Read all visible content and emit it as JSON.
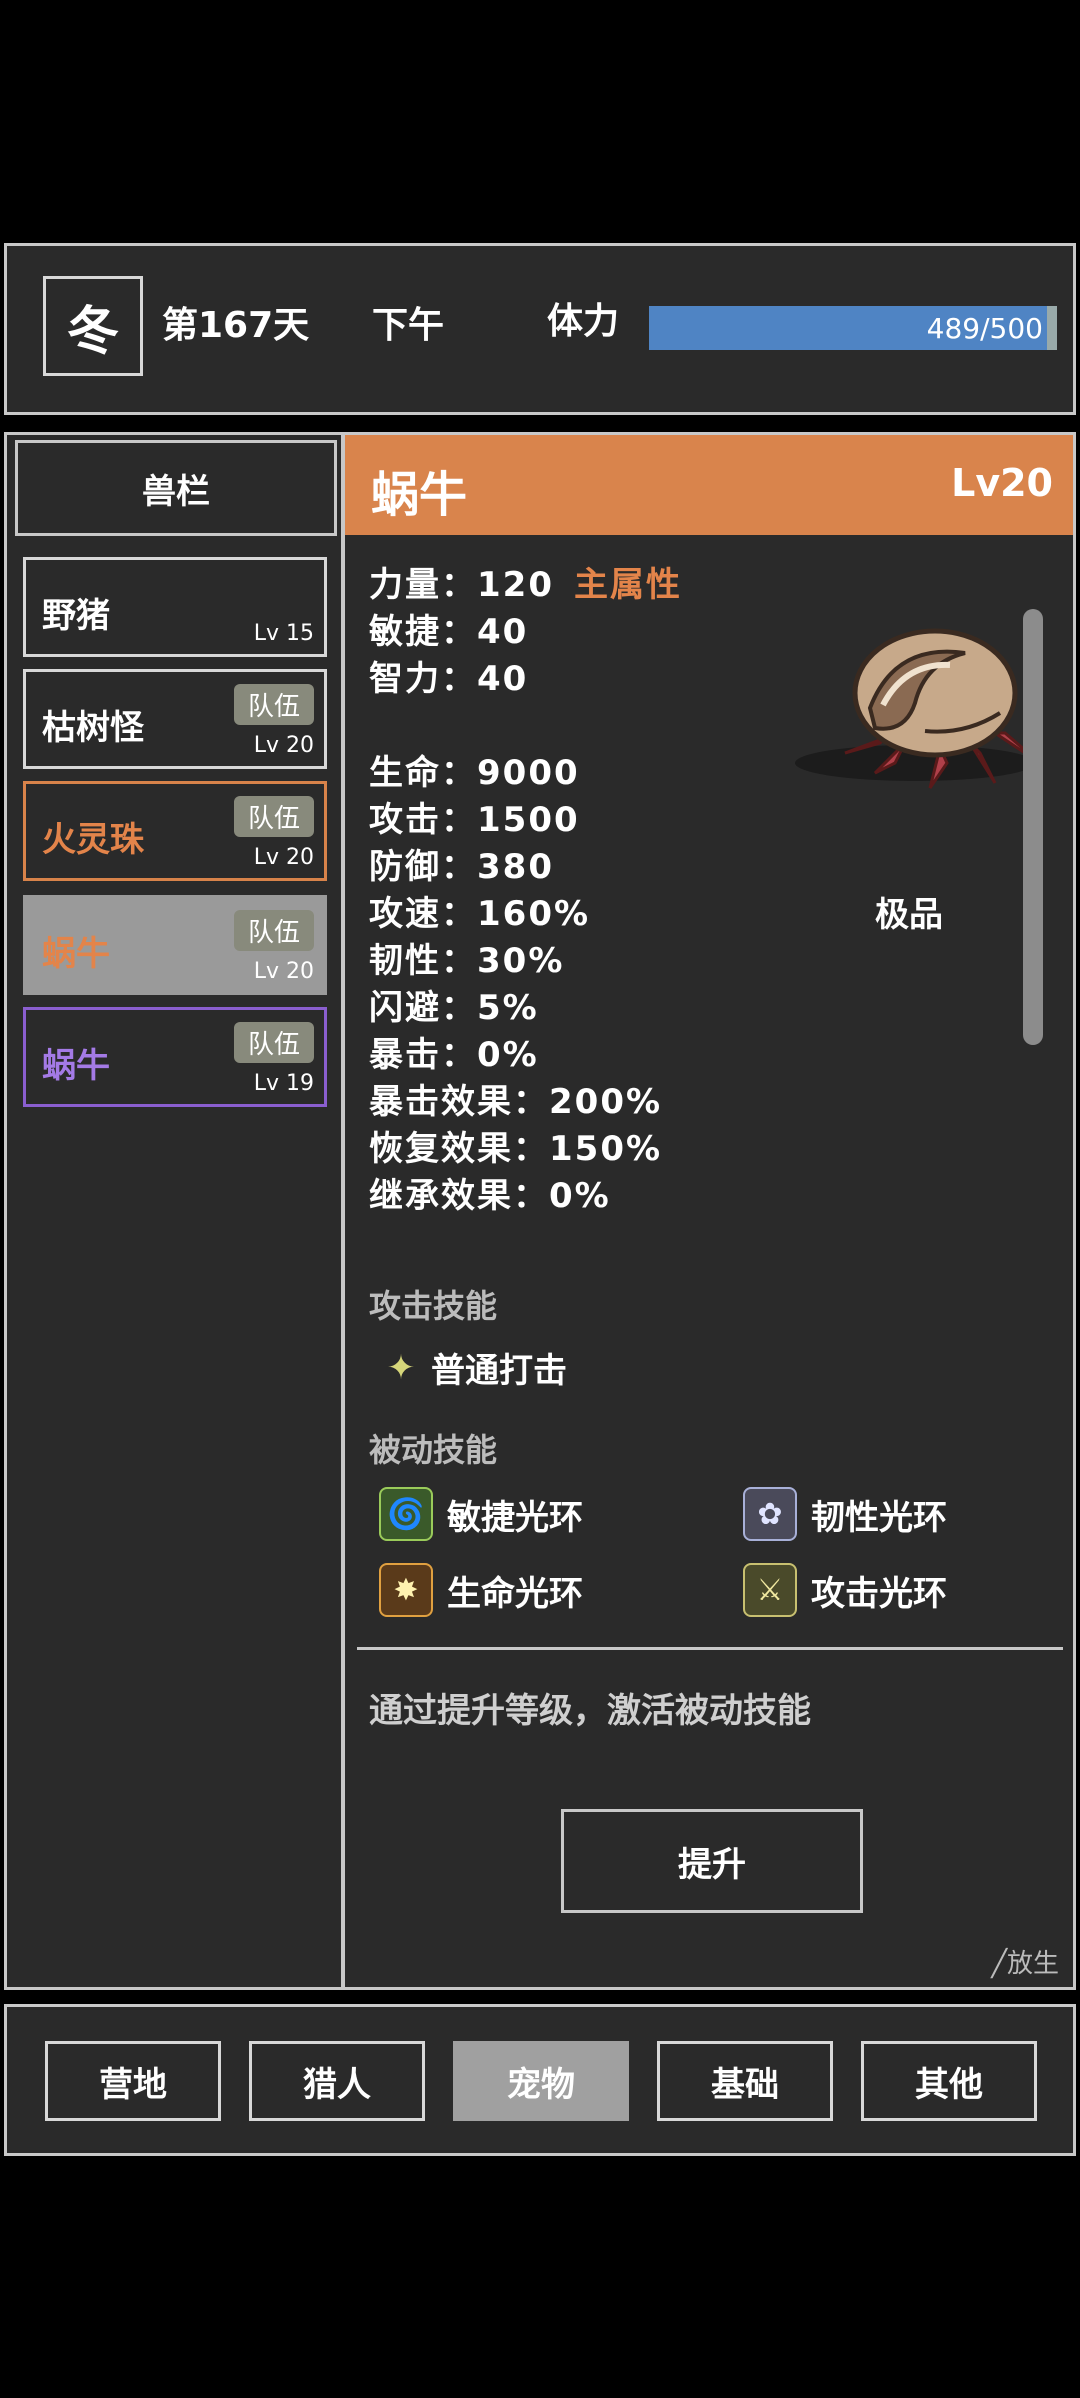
{
  "status": {
    "season": "冬",
    "day": "第167天",
    "time": "下午",
    "stamina_label": "体力",
    "stamina_text": "489/500",
    "stamina_fraction": 0.978
  },
  "pet_list": {
    "title": "兽栏",
    "items": [
      {
        "name": "野猪",
        "level": "Lv 15",
        "tag": ""
      },
      {
        "name": "枯树怪",
        "level": "Lv 20",
        "tag": "队伍"
      },
      {
        "name": "火灵珠",
        "level": "Lv 20",
        "tag": "队伍"
      },
      {
        "name": "蜗牛",
        "level": "Lv 20",
        "tag": "队伍"
      },
      {
        "name": "蜗牛",
        "level": "Lv 19",
        "tag": "队伍"
      }
    ]
  },
  "detail": {
    "name": "蜗牛",
    "level": "Lv20",
    "quality": "极品",
    "main_attr_label": "主属性",
    "stats": [
      "力量：120",
      "敏捷：40",
      "智力：40",
      "生命：9000",
      "攻击：1500",
      "防御：380",
      "攻速：160%",
      "韧性：30%",
      "闪避：5%",
      "暴击：0%",
      "暴击效果：200%",
      "恢复效果：150%",
      "继承效果：0%"
    ],
    "attack_skills_title": "攻击技能",
    "attack_skills": [
      "普通打击"
    ],
    "passive_skills_title": "被动技能",
    "passive_skills": [
      "敏捷光环",
      "韧性光环",
      "生命光环",
      "攻击光环"
    ],
    "hint": "通过提升等级，激活被动技能",
    "upgrade_label": "提升",
    "release_label": "╱放生"
  },
  "nav": {
    "items": [
      "营地",
      "猎人",
      "宠物",
      "基础",
      "其他"
    ],
    "active": "宠物"
  },
  "colors": {
    "accent_orange": "#d9844c",
    "stamina_blue": "#4f84c4",
    "purple": "#8a5ecf"
  }
}
